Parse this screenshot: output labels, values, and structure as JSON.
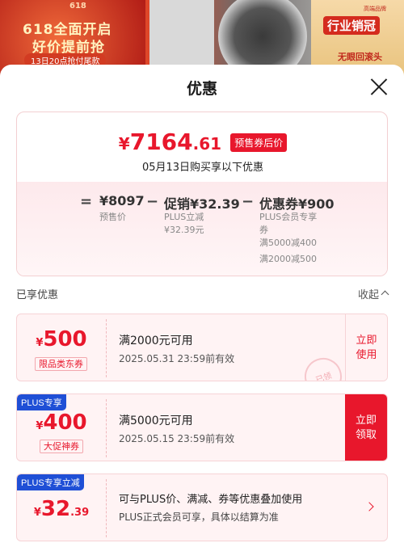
{
  "banner": {
    "tag_618": "618",
    "line1": "618全面开启",
    "line2": "好价提前抢",
    "line3": "13日20点抢付尾款",
    "right_top": "行业销冠",
    "right_mid": "无眼回滚头",
    "right_small": "高端品牌"
  },
  "sheet": {
    "title": "优惠"
  },
  "summary": {
    "price_symbol": "¥",
    "price_int": "7164",
    "price_dec": ".61",
    "price_tag": "预售券后价",
    "enjoy_line": "05月13日购买享以下优惠",
    "equals": "=",
    "presale_value": "¥8097",
    "presale_label": "预售价",
    "minus1": "−",
    "promo_value": "促销¥32.39",
    "promo_sub1": "PLUS立减",
    "promo_sub2": "¥32.39元",
    "minus2": "−",
    "coupon_value": "优惠券¥900",
    "coupon_sub1": "PLUS会员专享",
    "coupon_sub2": "券",
    "coupon_sub3": "满5000减400",
    "coupon_sub4": "满2000减500"
  },
  "enjoyed": {
    "label": "已享优惠",
    "collapse_label": "收起"
  },
  "coupons": [
    {
      "symbol": "¥",
      "amount": "500",
      "type": "限品类东券",
      "condition": "满2000元可用",
      "validity": "2025.05.31 23:59前有效",
      "action_line1": "立即",
      "action_line2": "使用",
      "stamp": "已领"
    },
    {
      "badge": "PLUS专享",
      "symbol": "¥",
      "amount": "400",
      "type": "大促神券",
      "condition": "满5000元可用",
      "validity": "2025.05.15 23:59前有效",
      "action_line1": "立即",
      "action_line2": "领取"
    },
    {
      "badge": "PLUS专享立减",
      "symbol": "¥",
      "amount": "32",
      "amount_dec": ".39",
      "condition": "可与PLUS价、满减、券等优惠叠加使用",
      "validity": "PLUS正式会员可享，具体以结算为准"
    }
  ],
  "colors": {
    "accent": "#e8172c",
    "plus_blue": "#1f4fd6",
    "card_bg": "#fff3f4"
  }
}
